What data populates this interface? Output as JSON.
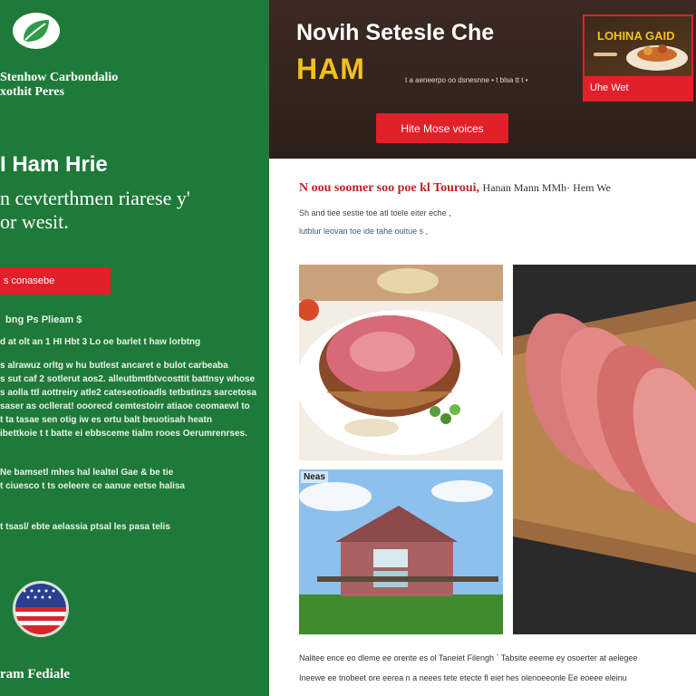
{
  "sidebar": {
    "brand_name": "Stenhow Carbondalio\nxothit Peres",
    "title": "I Ham Hrie",
    "subtitle": "n cevterthmen riarese y'\nor wesit.",
    "cta_label": "s conasebe",
    "lead": "bng Ps Plieam $",
    "paragraph_1": "d at olt an 1 HI Hbt 3 Lo oe barlet t haw lorbtng",
    "paragraph_2": "s alrawuz orltg w hu  butlest ancaret e bulot carbeaba\ns sut caf 2 sotlerut aos2. alleutbmtbtvcosttit battnsy whose\ns aolla ttl aottreiry atle2 cateseotioadls tetbstinzs sarcetosa\nsaser as ocllerat! ooorecd cemtestoirr atiaoe ceomaewl to\nt ta tasae sen otig iw es ortu balt beuotisah  heatn\nibettkoie t t batte ei ebbsceme tialm rooes Oerumrenrses.",
    "paragraph_3": "Ne bamsetl mhes hal lealtel Gae & be tie\nt ciuesco t ts oeleere ce aanue eetse halisa",
    "paragraph_4": "t tsasl/ ebte aelassia ptsal les pasa telis",
    "footer": "ram Fediale",
    "colors": {
      "bg": "#1f7a3a",
      "accent": "#e2202a"
    }
  },
  "hero": {
    "title": "Novih Setesle Che",
    "ham": "HAM",
    "small_line": "t a aeneerpo oo dsnesnne  •  t blsa tt t •",
    "button_label": "Hite Mose voices",
    "promo_label": "LOHINA GAID",
    "promo_button": "Uhe Wet",
    "colors": {
      "bg": "#3b2a22",
      "yellow": "#f4c01b"
    }
  },
  "content": {
    "heading_red": "N oou soomer soo poe kl Touroui,",
    "heading_rest": "Hanan Mann MMb· Hem We",
    "line_1": "Sh and tiee sestie toe atl toele eiter eche ,",
    "line_2": "lutblur leovan toe ide tahe ouitue s ,",
    "photo_3_label": "Neas",
    "bottom_1": "Nalitee ence eo dleme ee orente es ol Taneiet Filengh ` Tabsite eeeme ey osoerter at aelegee",
    "bottom_2": "Ineewe ee tnobeet ore eerea n a neees tete etecte fl eiet hes olenoeeonle Ee eoeee  eleinu"
  }
}
